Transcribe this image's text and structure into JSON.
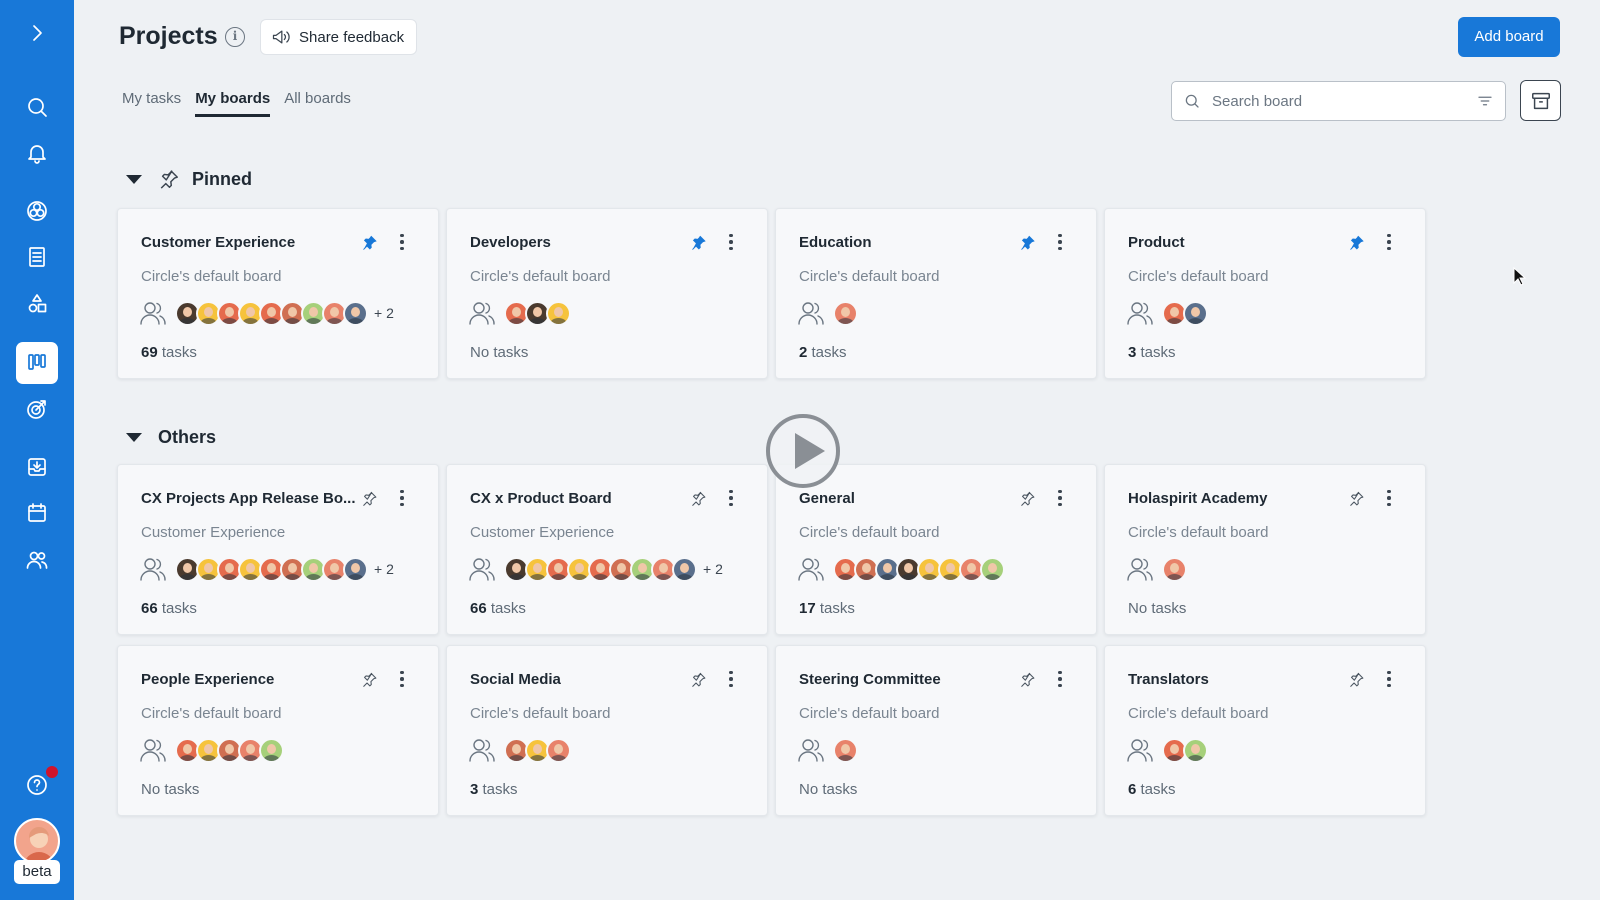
{
  "sidebar": {
    "items": [
      {
        "name": "expand",
        "icon": "chevron-right-icon"
      },
      {
        "name": "search",
        "icon": "search-icon"
      },
      {
        "name": "notifications",
        "icon": "bell-icon"
      },
      {
        "name": "circles",
        "icon": "circles-icon"
      },
      {
        "name": "documents",
        "icon": "document-icon"
      },
      {
        "name": "roles",
        "icon": "shapes-icon"
      },
      {
        "name": "projects",
        "icon": "board-icon",
        "active": true
      },
      {
        "name": "goals",
        "icon": "target-icon"
      },
      {
        "name": "inbox",
        "icon": "inbox-icon"
      },
      {
        "name": "calendar",
        "icon": "calendar-icon"
      },
      {
        "name": "people",
        "icon": "users-icon"
      }
    ],
    "help_icon": "help-icon",
    "beta_label": "beta",
    "accent": "#1878d8"
  },
  "header": {
    "title": "Projects",
    "info_icon": "i",
    "feedback_label": "Share feedback",
    "add_board_label": "Add board"
  },
  "tabs": [
    {
      "label": "My tasks",
      "active": false
    },
    {
      "label": "My boards",
      "active": true
    },
    {
      "label": "All boards",
      "active": false
    }
  ],
  "search": {
    "placeholder": "Search board"
  },
  "sections": {
    "pinned": {
      "title": "Pinned",
      "boards": [
        {
          "title": "Customer Experience",
          "subtitle": "Circle's default board",
          "pinned": true,
          "avatars": [
            "#4a3a2e",
            "#f6c33c",
            "#e56b4d",
            "#f6c33c",
            "#e56b4d",
            "#d06f52",
            "#a6d07a",
            "#e8826a",
            "#5a6f8c"
          ],
          "more": "+ 2",
          "tasks_count": "69",
          "tasks_label": "tasks"
        },
        {
          "title": "Developers",
          "subtitle": "Circle's default board",
          "pinned": true,
          "avatars": [
            "#e56b4d",
            "#4a3a2e",
            "#f6c33c"
          ],
          "more": "",
          "tasks_count": "",
          "tasks_label": "No tasks"
        },
        {
          "title": "Education",
          "subtitle": "Circle's default board",
          "pinned": true,
          "avatars": [
            "#e8826a"
          ],
          "more": "",
          "tasks_count": "2",
          "tasks_label": "tasks"
        },
        {
          "title": "Product",
          "subtitle": "Circle's default board",
          "pinned": true,
          "avatars": [
            "#e56b4d",
            "#5a6f8c"
          ],
          "more": "",
          "tasks_count": "3",
          "tasks_label": "tasks"
        }
      ]
    },
    "others": {
      "title": "Others",
      "boards": [
        {
          "title": "CX Projects App Release Bo...",
          "subtitle": "Customer Experience",
          "pinned": false,
          "avatars": [
            "#4a3a2e",
            "#f6c33c",
            "#e56b4d",
            "#f6c33c",
            "#e56b4d",
            "#d06f52",
            "#a6d07a",
            "#e8826a",
            "#5a6f8c"
          ],
          "more": "+ 2",
          "tasks_count": "66",
          "tasks_label": "tasks"
        },
        {
          "title": "CX x Product Board",
          "subtitle": "Customer Experience",
          "pinned": false,
          "avatars": [
            "#4a3a2e",
            "#f6c33c",
            "#e56b4d",
            "#f6c33c",
            "#e56b4d",
            "#d06f52",
            "#a6d07a",
            "#e8826a",
            "#5a6f8c"
          ],
          "more": "+ 2",
          "tasks_count": "66",
          "tasks_label": "tasks"
        },
        {
          "title": "General",
          "subtitle": "Circle's default board",
          "pinned": false,
          "avatars": [
            "#e56b4d",
            "#d06f52",
            "#5a6f8c",
            "#4a3a2e",
            "#f6c33c",
            "#f6c33c",
            "#e8826a",
            "#a6d07a"
          ],
          "more": "",
          "tasks_count": "17",
          "tasks_label": "tasks"
        },
        {
          "title": "Holaspirit Academy",
          "subtitle": "Circle's default board",
          "pinned": false,
          "avatars": [
            "#e8826a"
          ],
          "more": "",
          "tasks_count": "",
          "tasks_label": "No tasks"
        },
        {
          "title": "People Experience",
          "subtitle": "Circle's default board",
          "pinned": false,
          "avatars": [
            "#e56b4d",
            "#f6c33c",
            "#d06f52",
            "#e8826a",
            "#a6d07a"
          ],
          "more": "",
          "tasks_count": "",
          "tasks_label": "No tasks"
        },
        {
          "title": "Social Media",
          "subtitle": "Circle's default board",
          "pinned": false,
          "avatars": [
            "#d06f52",
            "#f6c33c",
            "#e8826a"
          ],
          "more": "",
          "tasks_count": "3",
          "tasks_label": "tasks"
        },
        {
          "title": "Steering Committee",
          "subtitle": "Circle's default board",
          "pinned": false,
          "avatars": [
            "#e8826a"
          ],
          "more": "",
          "tasks_count": "",
          "tasks_label": "No tasks"
        },
        {
          "title": "Translators",
          "subtitle": "Circle's default board",
          "pinned": false,
          "avatars": [
            "#e56b4d",
            "#a6d07a"
          ],
          "more": "",
          "tasks_count": "6",
          "tasks_label": "tasks"
        }
      ]
    }
  },
  "overlay": {
    "icon": "play-icon"
  }
}
